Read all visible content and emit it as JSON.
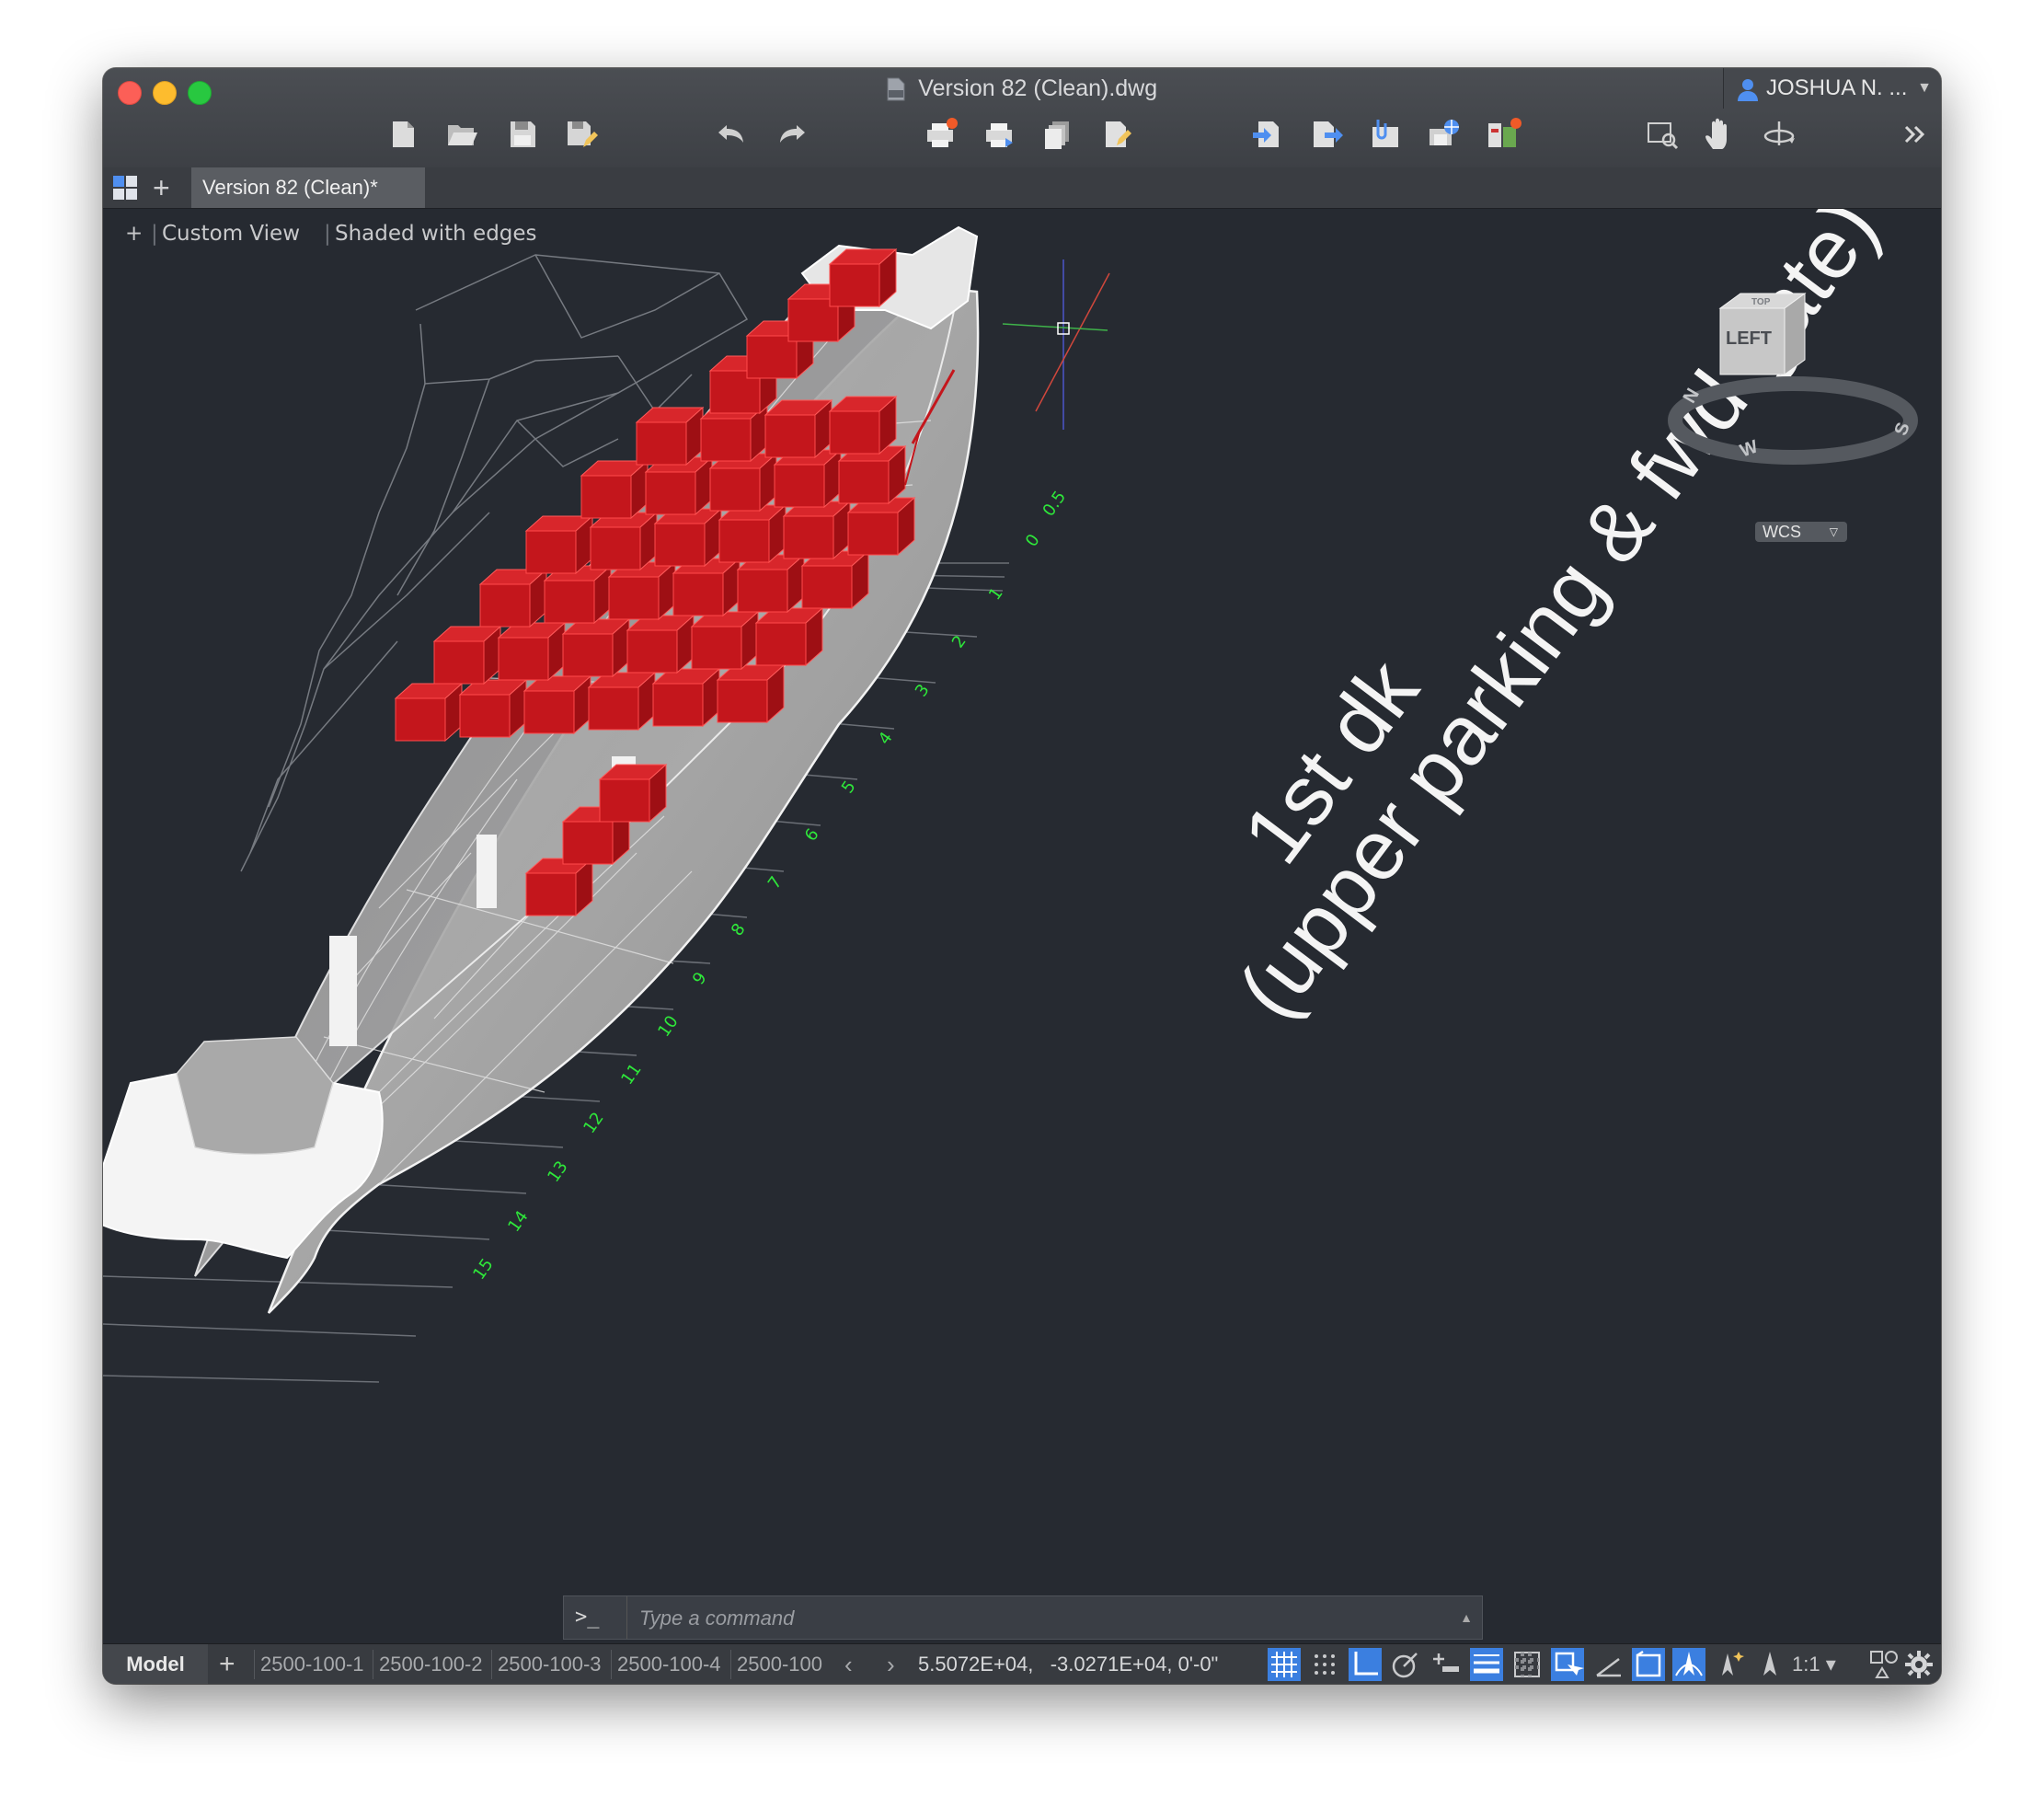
{
  "window": {
    "title": "Version 82 (Clean).dwg",
    "user": "JOSHUA N. ...",
    "doc_tab": "Version 82 (Clean)*"
  },
  "toolbar": {
    "icons": [
      "new-icon",
      "open-icon",
      "save-icon",
      "save-as-icon",
      "undo-icon",
      "redo-icon",
      "plot-icon",
      "batch-plot-icon",
      "publish-icon",
      "page-setup-icon",
      "import-icon",
      "export-icon",
      "attach-icon",
      "share-icon",
      "reference-manager-icon",
      "zoom-window-icon",
      "pan-icon",
      "orbit-icon",
      "overflow-icon"
    ]
  },
  "viewport": {
    "view_label": "Custom View",
    "style_label": "Shaded with edges",
    "annotation_line1": "1st dk",
    "annotation_line2": "(upper parking & fwd gate)",
    "frame_numbers": [
      "0",
      "0.5",
      "1",
      "2",
      "3",
      "4",
      "5",
      "6",
      "7",
      "8",
      "9",
      "10",
      "11",
      "12",
      "13",
      "14",
      "15"
    ],
    "viewcube_face": "LEFT",
    "viewcube_top": "TOP",
    "compass": {
      "n": "N",
      "w": "W",
      "s": "S"
    },
    "ucs_label": "WCS"
  },
  "command": {
    "prompt": ">_",
    "placeholder": "Type a command"
  },
  "status": {
    "model": "Model",
    "layouts": [
      "2500-100-1",
      "2500-100-2",
      "2500-100-3",
      "2500-100-4",
      "2500-100"
    ],
    "coords": "5.5072E+04,   -3.0271E+04, 0'-0\"",
    "scale": "1:1"
  },
  "colors": {
    "accent": "#3b7fe0",
    "viewport_bg": "#262a31",
    "cargo_red": "#c4161c",
    "frame_green": "#2ee83a"
  }
}
